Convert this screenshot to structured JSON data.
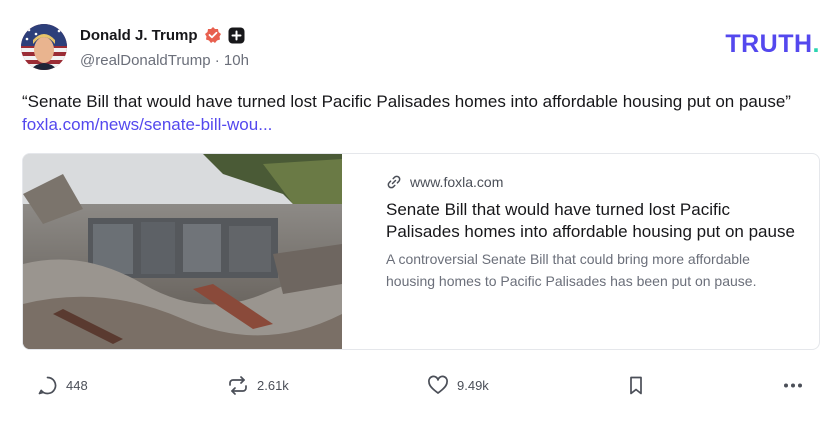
{
  "author": {
    "display_name": "Donald J. Trump",
    "handle": "@realDonaldTrump",
    "separator": "·",
    "time": "10h",
    "verified_icon": "verified-badge-icon",
    "follow_icon": "plus-square-icon"
  },
  "brand": {
    "logo_main": "TRUTH",
    "logo_dot": ".",
    "primary_color": "#5448ee",
    "accent_color": "#2ad4b0"
  },
  "post": {
    "text": "“Senate Bill that would have turned lost Pacific Palisades homes into affordable housing put on pause”",
    "link_text": "foxla.com/news/senate-bill-wou..."
  },
  "card": {
    "domain": "www.foxla.com",
    "title": "Senate Bill that would have turned lost Pacific Palisades homes into affordable housing put on pause",
    "description": "A controversial Senate Bill that could bring more affordable housing homes to Pacific Palisades has been put on pause.",
    "link_icon": "link-icon"
  },
  "actions": {
    "reply_count": "448",
    "retruth_count": "2.61k",
    "like_count": "9.49k",
    "reply_icon": "reply-bubble-icon",
    "retruth_icon": "retruth-icon",
    "like_icon": "heart-icon",
    "bookmark_icon": "bookmark-icon",
    "more_icon": "more-dots-icon"
  }
}
